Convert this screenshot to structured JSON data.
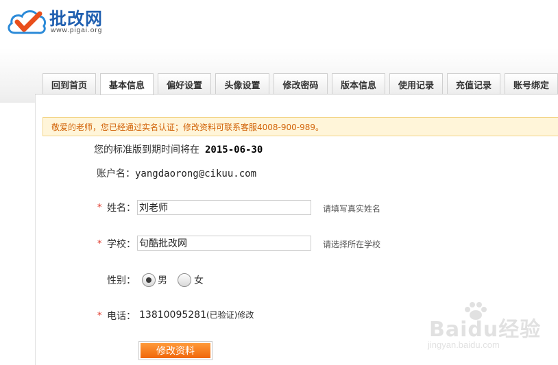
{
  "logo": {
    "name": "批改网",
    "url": "www.pigai.org"
  },
  "tabs": [
    {
      "label": "回到首页",
      "active": false
    },
    {
      "label": "基本信息",
      "active": true
    },
    {
      "label": "偏好设置",
      "active": false
    },
    {
      "label": "头像设置",
      "active": false
    },
    {
      "label": "修改密码",
      "active": false
    },
    {
      "label": "版本信息",
      "active": false
    },
    {
      "label": "使用记录",
      "active": false
    },
    {
      "label": "充值记录",
      "active": false
    },
    {
      "label": "账号绑定",
      "active": false
    }
  ],
  "notice": "敬爱的老师，您已经通过实名认证；修改资料可联系客服4008-900-989。",
  "expiry": {
    "text": "您的标准版到期时间将在",
    "date": "2015-06-30"
  },
  "account": {
    "label": "账户名：",
    "value": "yangdaorong@cikuu.com"
  },
  "form": {
    "required_mark": "*",
    "name": {
      "label": "姓名：",
      "value": "刘老师",
      "hint": "请填写真实姓名"
    },
    "school": {
      "label": "学校：",
      "value": "句酷批改网",
      "hint": "请选择所在学校"
    },
    "gender": {
      "label": "性别：",
      "options": [
        "男",
        "女"
      ],
      "selected": "男"
    },
    "phone": {
      "label": "电话：",
      "number": "13810095281",
      "status": "(已验证)",
      "edit": "修改"
    },
    "submit_label": "修改资料"
  },
  "watermark": {
    "text": "Baidu经验",
    "url": "jingyan.baidu.com"
  },
  "colors": {
    "accent": "#f0660a",
    "brand": "#1f5fb0",
    "notice_bg": "#fff5d9",
    "notice_text": "#d2640a",
    "required": "#e0382a"
  }
}
